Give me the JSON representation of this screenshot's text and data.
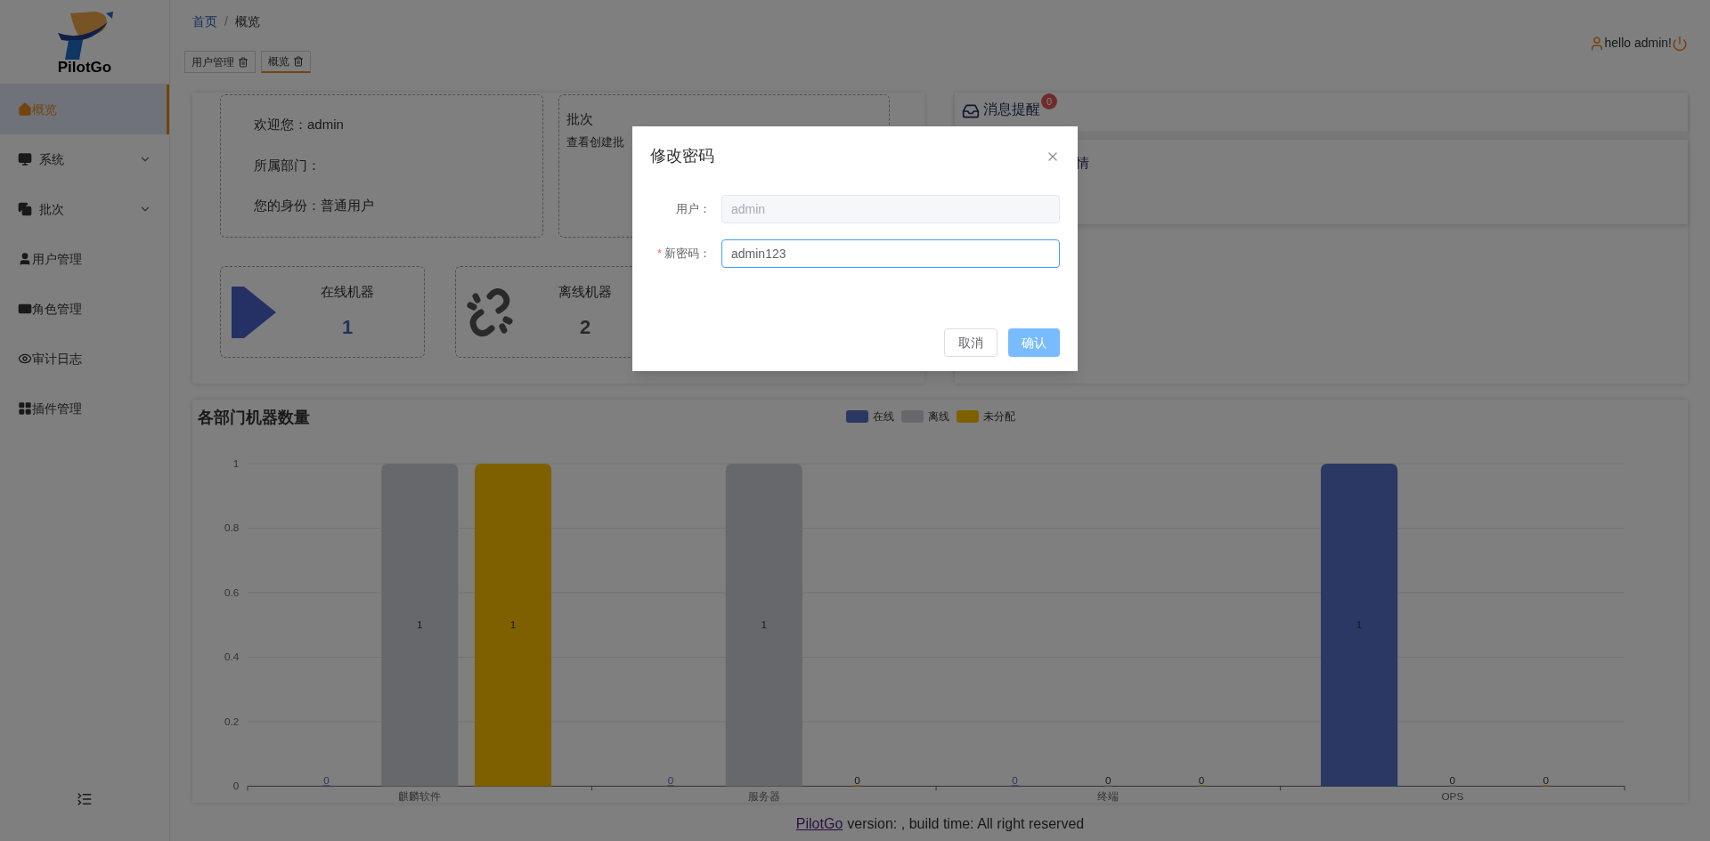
{
  "sidebar": {
    "logo_text": "PilotGo",
    "items": [
      {
        "label": "概览",
        "selected": true,
        "has_submenu": false
      },
      {
        "label": "系统",
        "selected": false,
        "has_submenu": true
      },
      {
        "label": "批次",
        "selected": false,
        "has_submenu": true
      },
      {
        "label": "用户管理",
        "selected": false,
        "has_submenu": false
      },
      {
        "label": "角色管理",
        "selected": false,
        "has_submenu": false
      },
      {
        "label": "审计日志",
        "selected": false,
        "has_submenu": false
      },
      {
        "label": "插件管理",
        "selected": false,
        "has_submenu": false
      }
    ]
  },
  "breadcrumb": {
    "separator": "/",
    "items": [
      {
        "label": "首页",
        "link": true
      },
      {
        "label": "概览",
        "link": false
      }
    ]
  },
  "tabs": [
    {
      "label": "用户管理",
      "selected": false
    },
    {
      "label": "概览",
      "selected": true
    }
  ],
  "user": {
    "greeting": "hello admin!"
  },
  "welcome_card": {
    "lines": [
      "欢迎您：admin",
      "所属部门：",
      "您的身份：普通用户"
    ]
  },
  "batch_card": {
    "title": "批次",
    "description": "查看创建批"
  },
  "stats": [
    {
      "label": "在线机器",
      "value": "1",
      "kind": "online"
    },
    {
      "label": "离线机器",
      "value": "2",
      "kind": "offline"
    }
  ],
  "messages": {
    "title": "消息提醒",
    "badge": "0",
    "item_text": "情"
  },
  "chart": {
    "title": "各部门机器数量",
    "chart_data": {
      "type": "bar",
      "categories": [
        "麒麟软件",
        "服务器",
        "终端",
        "OPS"
      ],
      "series": [
        {
          "name": "在线",
          "color": "#5470c6",
          "values": [
            0,
            0,
            0,
            1
          ]
        },
        {
          "name": "离线",
          "color": "#cfd0d6",
          "values": [
            1,
            1,
            0,
            0
          ]
        },
        {
          "name": "未分配",
          "color": "#ffc000",
          "values": [
            1,
            0,
            0,
            0
          ]
        }
      ],
      "ylim": [
        0,
        1
      ],
      "yticks": [
        0,
        0.2,
        0.4,
        0.6,
        0.8,
        1
      ],
      "grid": true,
      "data_labels": true
    }
  },
  "footer": {
    "link": "PilotGo",
    "text": "version: , build time: All right reserved"
  },
  "dialog": {
    "title": "修改密码",
    "required_mark": "*",
    "fields": [
      {
        "label": "用户：",
        "value": "admin",
        "required": false,
        "disabled": true,
        "focused": false
      },
      {
        "label": "新密码：",
        "value": "admin123",
        "required": true,
        "disabled": false,
        "focused": true
      }
    ],
    "buttons": [
      {
        "label": "取消",
        "kind": "secondary",
        "disabled": false
      },
      {
        "label": "确认",
        "kind": "primary",
        "disabled": true
      }
    ]
  }
}
